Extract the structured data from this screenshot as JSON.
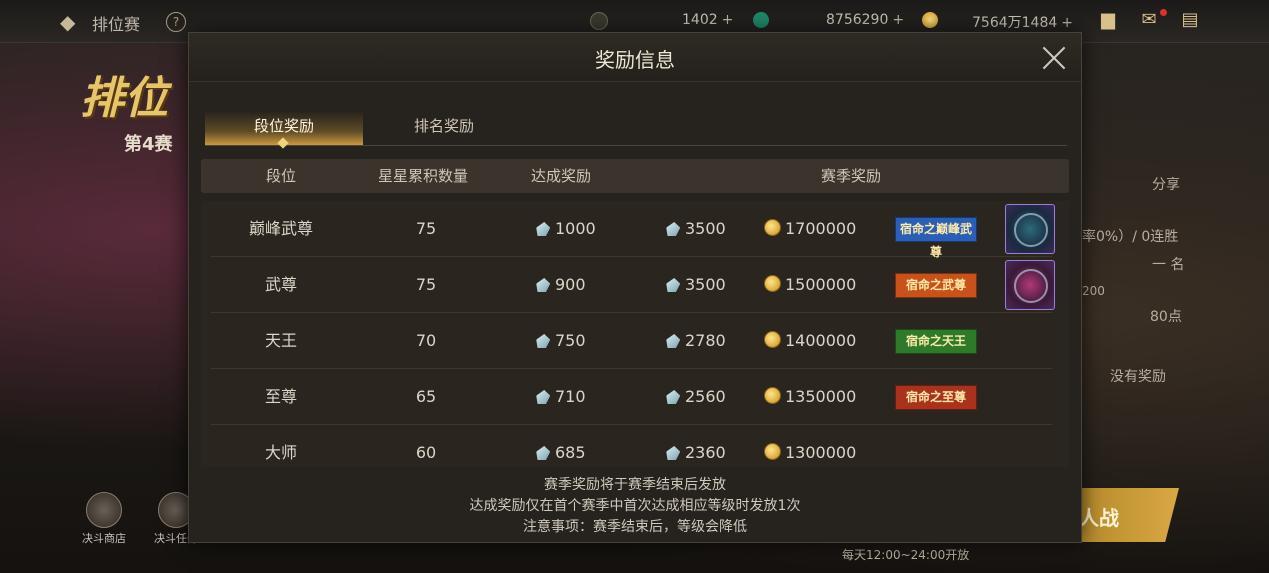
{
  "topbar": {
    "back_label": "排位赛",
    "help_label": "?",
    "resources": [
      {
        "icon": "gem-icon",
        "value": "1402"
      },
      {
        "icon": "jade-icon",
        "value": "8756290"
      },
      {
        "icon": "gold-coin-icon",
        "value": "7564万1484"
      }
    ],
    "plus": "+"
  },
  "background": {
    "banner_title": "排位",
    "season_label": "第4赛",
    "right_texts": [
      "分享",
      "率0%）/ 0连胜",
      "一 名",
      "200",
      "80点",
      "没有奖励"
    ],
    "bottom_items": [
      "决斗商店",
      "决斗任务"
    ],
    "battle_button": "人战",
    "open_time": "每天12:00~24:00开放"
  },
  "modal": {
    "title": "奖励信息",
    "tabs": [
      {
        "label": "段位奖励",
        "active": true
      },
      {
        "label": "排名奖励",
        "active": false
      }
    ],
    "columns": {
      "rank": "段位",
      "stars": "星星累积数量",
      "achieve": "达成奖励",
      "season": "赛季奖励"
    },
    "rows": [
      {
        "rank": "巅峰武尊",
        "stars": "75",
        "achieve": "1000",
        "season_gem": "3500",
        "season_gold": "1700000",
        "title_badge": "宿命之巅峰武尊",
        "badge_color": "#2a5fb8",
        "frame": "teal"
      },
      {
        "rank": "武尊",
        "stars": "75",
        "achieve": "900",
        "season_gem": "3500",
        "season_gold": "1500000",
        "title_badge": "宿命之武尊",
        "badge_color": "#c8521a",
        "frame": "pink"
      },
      {
        "rank": "天王",
        "stars": "70",
        "achieve": "750",
        "season_gem": "2780",
        "season_gold": "1400000",
        "title_badge": "宿命之天王",
        "badge_color": "#2d7a2a",
        "frame": null
      },
      {
        "rank": "至尊",
        "stars": "65",
        "achieve": "710",
        "season_gem": "2560",
        "season_gold": "1350000",
        "title_badge": "宿命之至尊",
        "badge_color": "#a8321c",
        "frame": null
      },
      {
        "rank": "大师",
        "stars": "60",
        "achieve": "685",
        "season_gem": "2360",
        "season_gold": "1300000",
        "title_badge": null,
        "badge_color": null,
        "frame": null
      }
    ],
    "notes": [
      "赛季奖励将于赛季结束后发放",
      "达成奖励仅在首个赛季中首次达成相应等级时发放1次",
      "注意事项：赛季结束后，等级会降低"
    ]
  }
}
